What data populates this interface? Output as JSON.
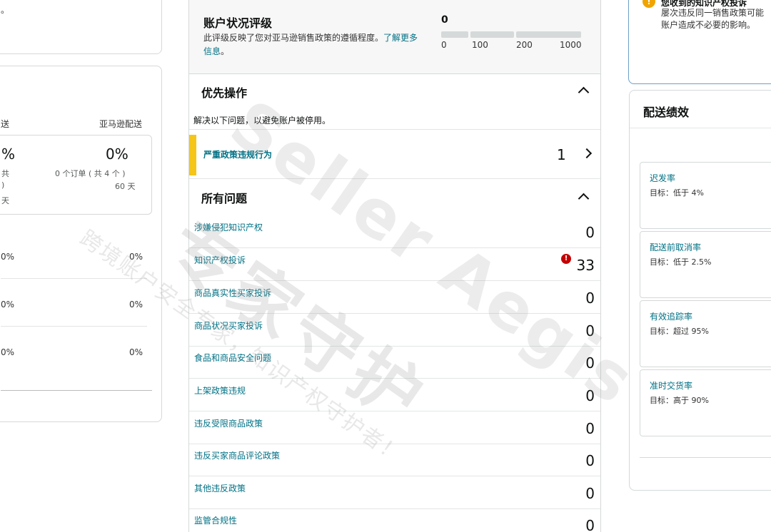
{
  "left": {
    "top_fragment": "。",
    "col_left": "送",
    "col_right": "亚马逊配送",
    "box_pct_left": "%",
    "box_pct_right": "0%",
    "box_sub_left_1": "共",
    "box_sub_left_2": ")",
    "box_sub_left_3": "天",
    "box_sub_right_1": "0 个订单 ( 共 4 个 )",
    "box_sub_right_2": "60 天",
    "rows": [
      {
        "left": "0%",
        "right": "0%"
      },
      {
        "left": "0%",
        "right": "0%"
      },
      {
        "left": "0%",
        "right": "0%"
      }
    ]
  },
  "account_health": {
    "title": "账户状况评级",
    "description": "此评级反映了您对亚马逊销售政策的遵循程度。",
    "learn_more": "了解更多信息",
    "period": "。",
    "score": "0",
    "ticks": [
      "0",
      "100",
      "200",
      "1000"
    ]
  },
  "priority": {
    "title": "优先操作",
    "note": "解决以下问题，以避免账户被停用。",
    "severe_label": "严重政策违规行为",
    "severe_count": "1"
  },
  "all_issues": {
    "title": "所有问题",
    "items": [
      {
        "label": "涉嫌侵犯知识产权",
        "count": "0"
      },
      {
        "label": "知识产权投诉",
        "count": "33",
        "alert": "!"
      },
      {
        "label": "商品真实性买家投诉",
        "count": "0"
      },
      {
        "label": "商品状况买家投诉",
        "count": "0"
      },
      {
        "label": "食品和商品安全问题",
        "count": "0"
      },
      {
        "label": "上架政策违规",
        "count": "0"
      },
      {
        "label": "违反受限商品政策",
        "count": "0"
      },
      {
        "label": "违反买家商品评论政策",
        "count": "0"
      },
      {
        "label": "其他违反政策",
        "count": "0"
      },
      {
        "label": "监管合规性",
        "count": "0"
      }
    ]
  },
  "notice": {
    "icon": "!",
    "heading": "您收到的知识产权投诉",
    "line1": "屡次违反同一销售政策可能",
    "line2": "账户造成不必要的影响。"
  },
  "shipping": {
    "title": "配送绩效",
    "metrics": [
      {
        "name": "迟发率",
        "target": "目标：低于 4%"
      },
      {
        "name": "配送前取消率",
        "target": "目标：低于 2.5%"
      },
      {
        "name": "有效追踪率",
        "target": "目标：超过 95%"
      },
      {
        "name": "准时交货率",
        "target": "目标：高于 90%"
      }
    ]
  },
  "watermark": {
    "line_big": "专家守护",
    "line_latin": "Seller Aegis",
    "line_small": "跨境账户安全专家，知识产权守护者！"
  },
  "colors": {
    "link": "#007185",
    "severe_bar": "#f5c518",
    "alert": "#c40000",
    "warning": "#f0a400"
  }
}
